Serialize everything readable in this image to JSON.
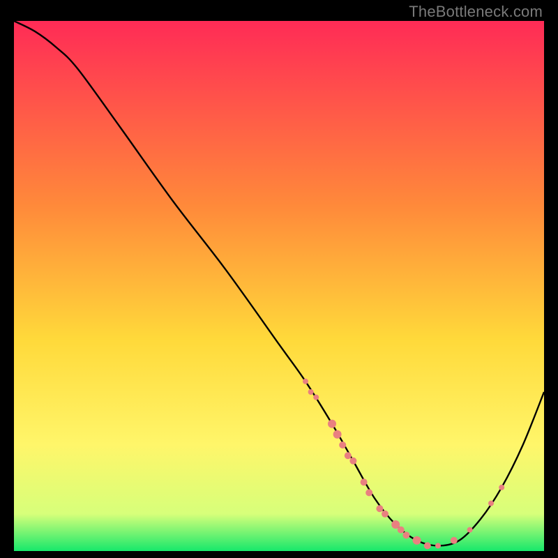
{
  "watermark": "TheBottleneck.com",
  "chart_data": {
    "type": "line",
    "title": "",
    "xlabel": "",
    "ylabel": "",
    "xlim": [
      0,
      100
    ],
    "ylim": [
      0,
      100
    ],
    "grid": false,
    "legend": false,
    "background_gradient": {
      "stops": [
        {
          "offset": 0.0,
          "color": "#ff2b56"
        },
        {
          "offset": 0.35,
          "color": "#ff8a3a"
        },
        {
          "offset": 0.6,
          "color": "#ffd93a"
        },
        {
          "offset": 0.8,
          "color": "#fff66a"
        },
        {
          "offset": 0.93,
          "color": "#d7ff7a"
        },
        {
          "offset": 1.0,
          "color": "#17e86b"
        }
      ]
    },
    "series": [
      {
        "name": "bottleneck-curve",
        "color": "#000000",
        "x": [
          0,
          4,
          8,
          12,
          20,
          30,
          40,
          50,
          55,
          60,
          64,
          68,
          72,
          76,
          80,
          84,
          88,
          92,
          96,
          100
        ],
        "y": [
          100,
          98,
          95,
          91,
          80,
          66,
          53,
          39,
          32,
          24,
          17,
          10,
          5,
          2,
          1,
          2,
          6,
          12,
          20,
          30
        ]
      }
    ],
    "markers": {
      "name": "highlight-dots",
      "color": "#e98080",
      "points": [
        {
          "x": 55,
          "y": 32,
          "r": 4
        },
        {
          "x": 56,
          "y": 30,
          "r": 4
        },
        {
          "x": 57,
          "y": 29,
          "r": 4
        },
        {
          "x": 60,
          "y": 24,
          "r": 6
        },
        {
          "x": 61,
          "y": 22,
          "r": 6
        },
        {
          "x": 62,
          "y": 20,
          "r": 5
        },
        {
          "x": 63,
          "y": 18,
          "r": 5
        },
        {
          "x": 64,
          "y": 17,
          "r": 5
        },
        {
          "x": 66,
          "y": 13,
          "r": 5
        },
        {
          "x": 67,
          "y": 11,
          "r": 5
        },
        {
          "x": 69,
          "y": 8,
          "r": 5
        },
        {
          "x": 70,
          "y": 7,
          "r": 5
        },
        {
          "x": 72,
          "y": 5,
          "r": 6
        },
        {
          "x": 73,
          "y": 4,
          "r": 5
        },
        {
          "x": 74,
          "y": 3,
          "r": 5
        },
        {
          "x": 76,
          "y": 2,
          "r": 6
        },
        {
          "x": 78,
          "y": 1,
          "r": 5
        },
        {
          "x": 80,
          "y": 1,
          "r": 4
        },
        {
          "x": 83,
          "y": 2,
          "r": 5
        },
        {
          "x": 86,
          "y": 4,
          "r": 4
        },
        {
          "x": 90,
          "y": 9,
          "r": 4
        },
        {
          "x": 92,
          "y": 12,
          "r": 4
        }
      ]
    }
  }
}
